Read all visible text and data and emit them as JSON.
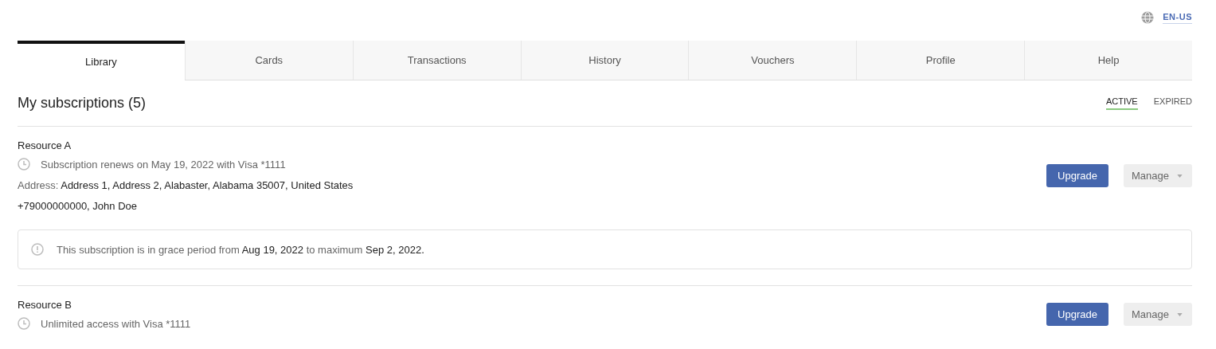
{
  "language": {
    "label": "EN-US"
  },
  "tabs": [
    {
      "label": "Library",
      "selected": true
    },
    {
      "label": "Cards",
      "selected": false
    },
    {
      "label": "Transactions",
      "selected": false
    },
    {
      "label": "History",
      "selected": false
    },
    {
      "label": "Vouchers",
      "selected": false
    },
    {
      "label": "Profile",
      "selected": false
    },
    {
      "label": "Help",
      "selected": false
    }
  ],
  "heading": "My subscriptions (5)",
  "filters": [
    {
      "label": "ACTIVE",
      "selected": true
    },
    {
      "label": "EXPIRED",
      "selected": false
    }
  ],
  "subscriptions": [
    {
      "name": "Resource A",
      "status": "Subscription renews on May 19, 2022 with Visa *1111",
      "address_label": "Address:",
      "address": "Address 1, Address 2, Alabaster, Alabama 35007, United States",
      "contact": "+79000000000, John Doe",
      "notice": [
        {
          "text": "This subscription is in grace period from ",
          "strong": false
        },
        {
          "text": "Aug 19, 2022",
          "strong": true
        },
        {
          "text": " to maximum ",
          "strong": false
        },
        {
          "text": "Sep 2, 2022.",
          "strong": true
        }
      ],
      "upgrade": "Upgrade",
      "manage": "Manage"
    },
    {
      "name": "Resource B",
      "status": "Unlimited access with Visa *1111",
      "upgrade": "Upgrade",
      "manage": "Manage"
    }
  ]
}
